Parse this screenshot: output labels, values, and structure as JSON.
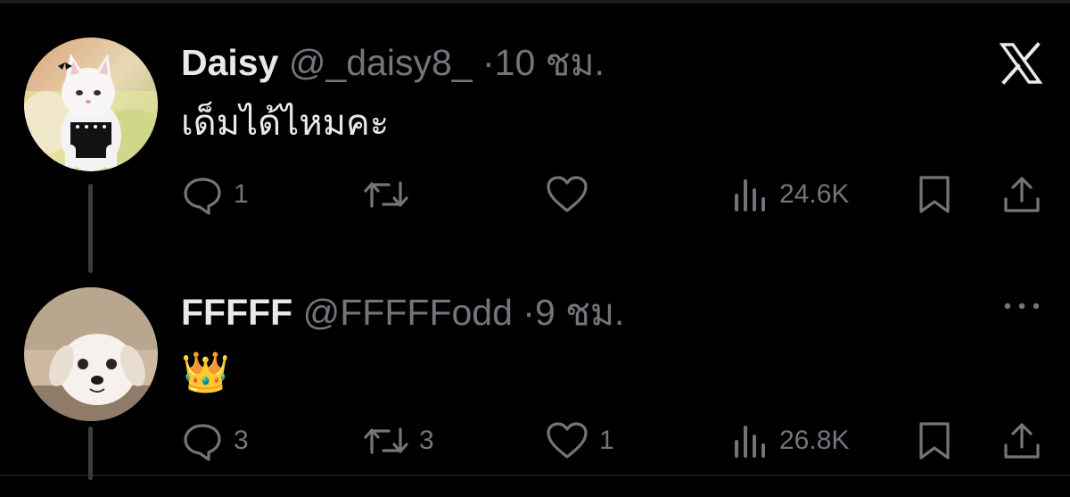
{
  "tweets": [
    {
      "name": "Daisy",
      "handle": "@_daisy8_",
      "separator": "·",
      "time": "10 ชม.",
      "text": "เด็มได้ไหมคะ",
      "counts": {
        "reply": "1",
        "retweet": "",
        "like": "",
        "views": "24.6K"
      }
    },
    {
      "name": "FFFFF",
      "handle": "@FFFFFodd",
      "separator": "·",
      "time": "9 ชม.",
      "text": "👑",
      "counts": {
        "reply": "3",
        "retweet": "3",
        "like": "1",
        "views": "26.8K"
      }
    }
  ],
  "colors": {
    "background": "#000000",
    "primary_text": "#e7e9ea",
    "secondary_text": "#71767b",
    "thread_line": "#3a3d40"
  },
  "icons": [
    "x-logo-icon",
    "reply-icon",
    "retweet-icon",
    "like-icon",
    "views-icon",
    "bookmark-icon",
    "share-icon",
    "more-icon"
  ]
}
